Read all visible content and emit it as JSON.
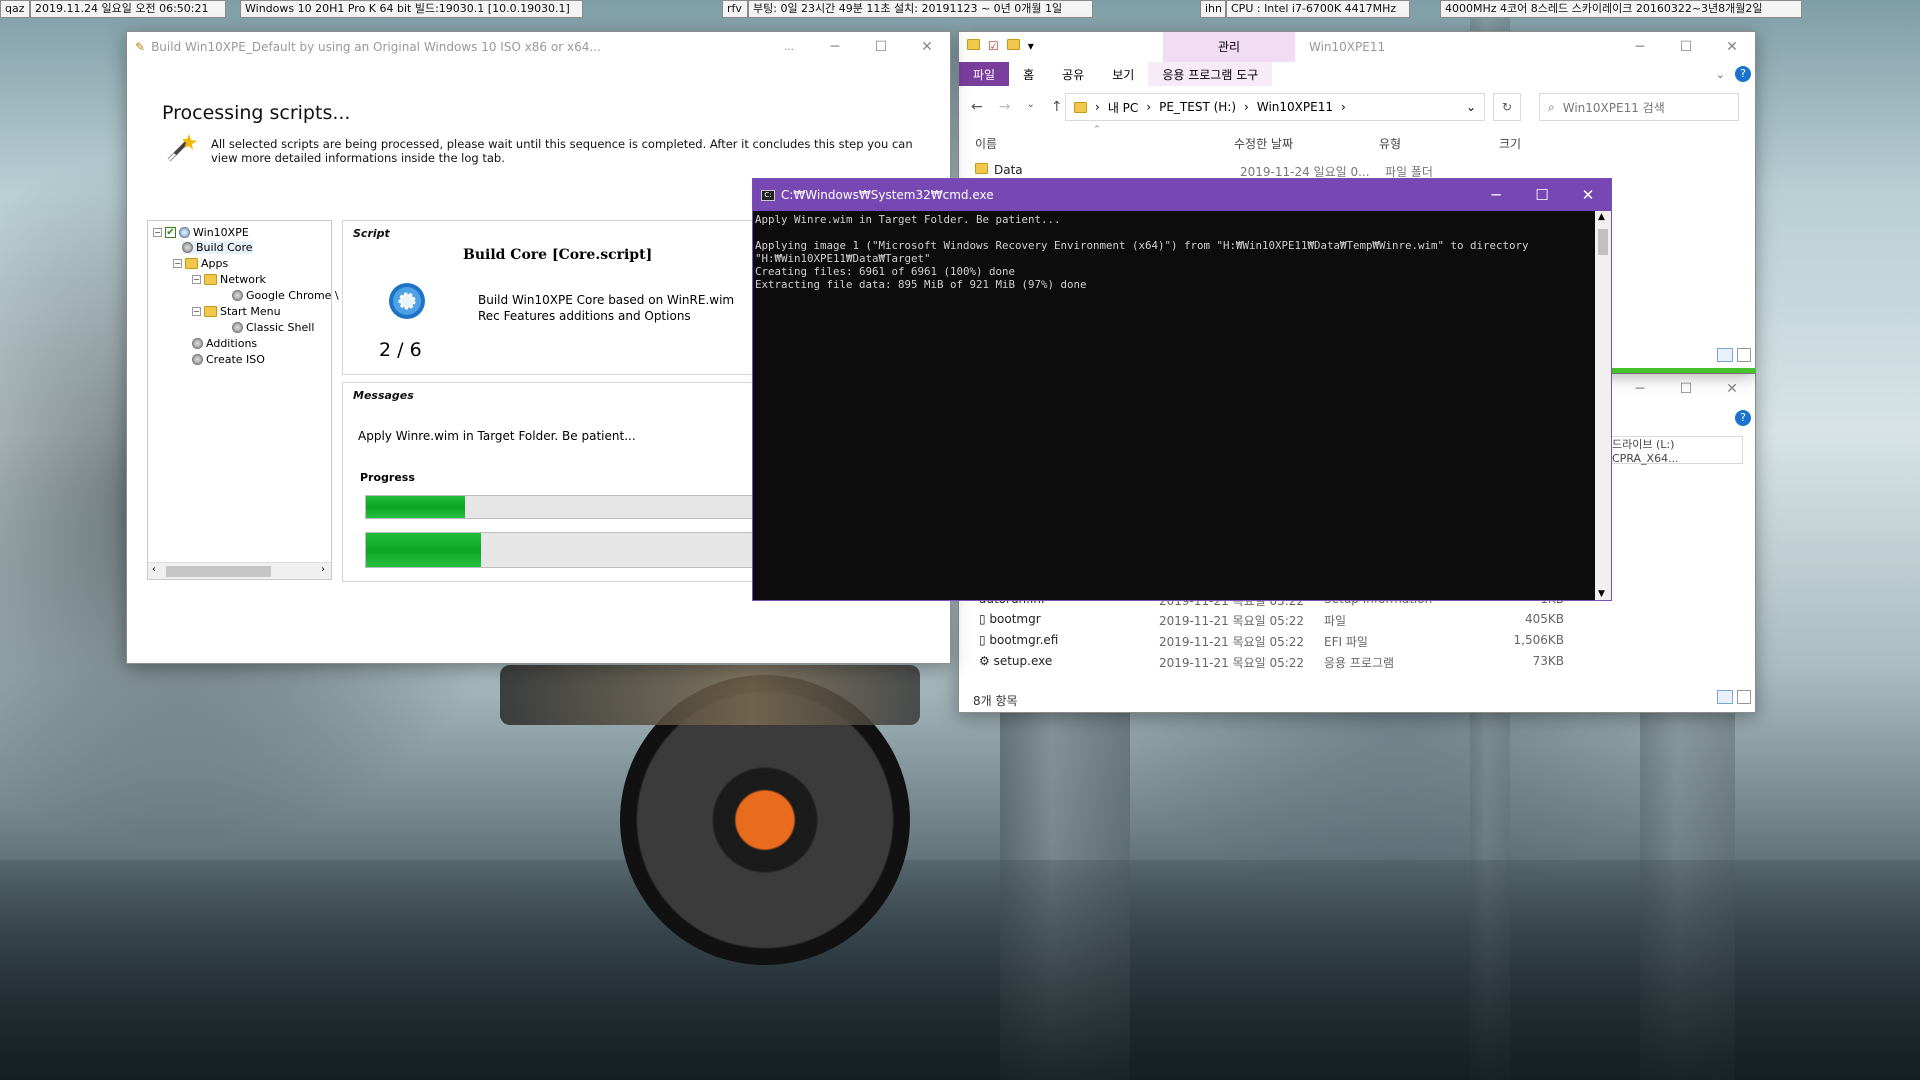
{
  "taskbar_info": [
    {
      "key": "qaz",
      "value": "2019.11.24 일요일 오전 06:50:21"
    },
    {
      "key": "",
      "value": "Windows 10 20H1 Pro K 64 bit 빌드:19030.1 [10.0.19030.1]"
    },
    {
      "key": "rfv",
      "value": "부팅: 0일 23시간 49분 11초 설치: 20191123 ~ 0년 0개월 1일"
    },
    {
      "key": "ihn",
      "value": "CPU : Intel i7-6700K 4417MHz"
    },
    {
      "key": "",
      "value": "4000MHz 4코어 8스레드 스카이레이크 20160322~3년8개월2일"
    }
  ],
  "winbuilder": {
    "title": "Build Win10XPE_Default by using an Original Windows 10 ISO x86 or x64...",
    "heading": "Processing scripts...",
    "description": "All selected scripts are being processed, please wait until this sequence is completed. After it concludes this step you can view more detailed informations inside the log tab.",
    "tree": {
      "root": "Win10XPE",
      "build_core": "Build Core",
      "apps": "Apps",
      "network": "Network",
      "chrome": "Google Chrome \\",
      "start_menu": "Start Menu",
      "classic_shell": "Classic Shell",
      "additions": "Additions",
      "create_iso": "Create ISO"
    },
    "script_caption": "Script",
    "script_name": "Build Core [Core.script]",
    "script_desc": "Build Win10XPE Core based on WinRE.wim Rec Features additions and Options",
    "counter": "2 / 6",
    "messages_caption": "Messages",
    "message": "Apply Winre.wim in Target Folder. Be patient...",
    "progress_caption": "Progress",
    "progress1": 0.25,
    "progress2": 0.29
  },
  "explorer_main": {
    "title": "Win10XPE11",
    "context_tab": "관리",
    "tabs": [
      "파일",
      "홈",
      "공유",
      "보기",
      "응용 프로그램 도구"
    ],
    "address": [
      "내 PC",
      "PE_TEST (H:)",
      "Win10XPE11"
    ],
    "search_placeholder": "Win10XPE11 검색",
    "columns": [
      "이름",
      "수정한 날짜",
      "유형",
      "크기"
    ],
    "rows": [
      {
        "name": "Data",
        "date": "2019-11-24 일요일 0...",
        "type": "파일 폴더",
        "size": ""
      }
    ]
  },
  "explorer_second": {
    "address": "드라이브 (L:) CPRA_X64...",
    "rows": [
      {
        "name": "autorun.inf",
        "date": "2019-11-21 목요일 05:22",
        "type": "Setup Information",
        "size": "1KB"
      },
      {
        "name": "bootmgr",
        "date": "2019-11-21 목요일 05:22",
        "type": "파일",
        "size": "405KB"
      },
      {
        "name": "bootmgr.efi",
        "date": "2019-11-21 목요일 05:22",
        "type": "EFI 파일",
        "size": "1,506KB"
      },
      {
        "name": "setup.exe",
        "date": "2019-11-21 목요일 05:22",
        "type": "응용 프로그램",
        "size": "73KB"
      }
    ],
    "status": "8개 항목"
  },
  "cmd": {
    "title": "C:₩Windows₩System32₩cmd.exe",
    "lines": [
      "Apply Winre.wim in Target Folder. Be patient...",
      "",
      "Applying image 1 (\"Microsoft Windows Recovery Environment (x64)\") from \"H:₩Win10XPE11₩Data₩Temp₩Winre.wim\" to directory",
      "\"H:₩Win10XPE11₩Data₩Target\"",
      "Creating files: 6961 of 6961 (100%) done",
      "Extracting file data: 895 MiB of 921 MiB (97%) done"
    ]
  },
  "colors": {
    "cmd_title": "#7747b3",
    "progress": "#13ad2b",
    "context_tab": "#f2dcf4"
  }
}
